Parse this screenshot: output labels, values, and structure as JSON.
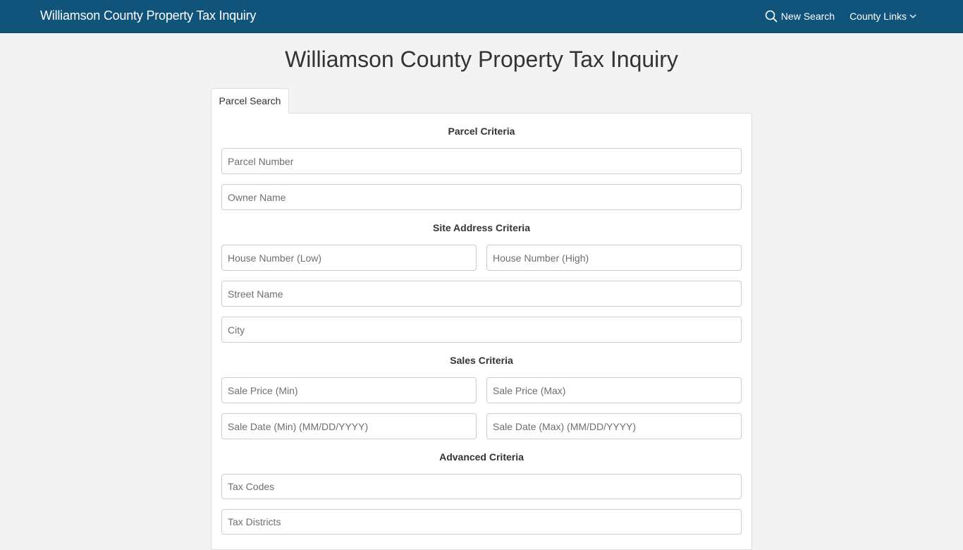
{
  "navbar": {
    "brand": "Williamson County Property Tax Inquiry",
    "new_search_label": "New Search",
    "county_links_label": "County Links",
    "icons": {
      "new_search": "search-icon",
      "county_links": "chevron-down-icon"
    }
  },
  "page": {
    "title": "Williamson County Property Tax Inquiry"
  },
  "tabs": [
    {
      "label": "Parcel Search",
      "active": true
    }
  ],
  "form": {
    "parcel": {
      "heading": "Parcel Criteria",
      "parcel_number": {
        "placeholder": "Parcel Number",
        "value": ""
      },
      "owner_name": {
        "placeholder": "Owner Name",
        "value": ""
      }
    },
    "site_address": {
      "heading": "Site Address Criteria",
      "house_low": {
        "placeholder": "House Number (Low)",
        "value": ""
      },
      "house_high": {
        "placeholder": "House Number (High)",
        "value": ""
      },
      "street_name": {
        "placeholder": "Street Name",
        "value": ""
      },
      "city": {
        "placeholder": "City",
        "value": ""
      }
    },
    "sales": {
      "heading": "Sales Criteria",
      "price_min": {
        "placeholder": "Sale Price (Min)",
        "value": ""
      },
      "price_max": {
        "placeholder": "Sale Price (Max)",
        "value": ""
      },
      "date_min": {
        "placeholder": "Sale Date (Min) (MM/DD/YYYY)",
        "value": ""
      },
      "date_max": {
        "placeholder": "Sale Date (Max) (MM/DD/YYYY)",
        "value": ""
      }
    },
    "advanced": {
      "heading": "Advanced Criteria",
      "tax_codes": {
        "placeholder": "Tax Codes",
        "value": ""
      },
      "tax_districts": {
        "placeholder": "Tax Districts",
        "value": ""
      }
    }
  },
  "colors": {
    "navbar_bg": "#10547c",
    "page_bg": "#f3f3f3",
    "panel_bg": "#ffffff",
    "border": "#cccccc"
  }
}
